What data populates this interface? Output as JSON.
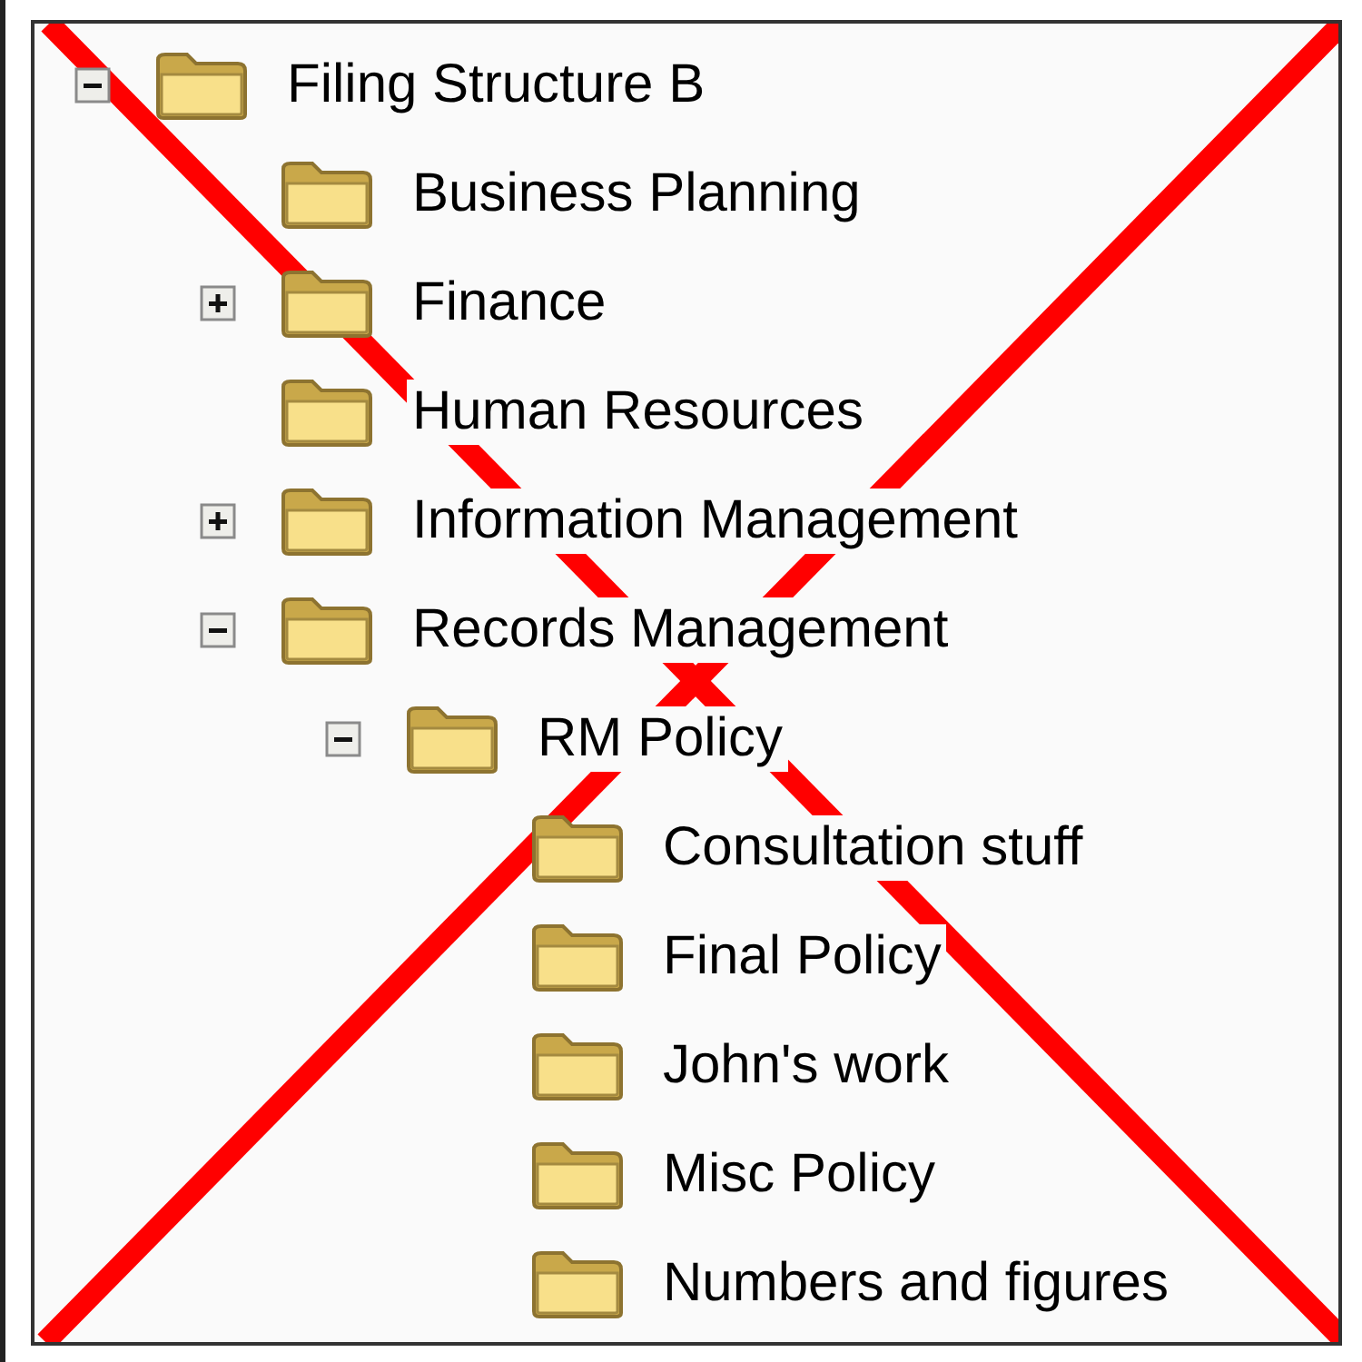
{
  "tree": [
    {
      "label": "Filing Structure B",
      "expandable": true,
      "expanded": true,
      "children": [
        {
          "label": "Business Planning",
          "expandable": false
        },
        {
          "label": "Finance",
          "expandable": true,
          "expanded": false
        },
        {
          "label": "Human Resources",
          "expandable": false
        },
        {
          "label": "Information Management",
          "expandable": true,
          "expanded": false
        },
        {
          "label": "Records Management",
          "expandable": true,
          "expanded": true,
          "children": [
            {
              "label": "RM Policy",
              "expandable": true,
              "expanded": true,
              "children": [
                {
                  "label": "Consultation stuff",
                  "expandable": false
                },
                {
                  "label": "Final Policy",
                  "expandable": false
                },
                {
                  "label": "John's work",
                  "expandable": false
                },
                {
                  "label": "Misc Policy",
                  "expandable": false
                },
                {
                  "label": "Numbers and figures",
                  "expandable": false
                }
              ]
            }
          ]
        }
      ]
    }
  ],
  "overlay": {
    "kind": "cross"
  }
}
